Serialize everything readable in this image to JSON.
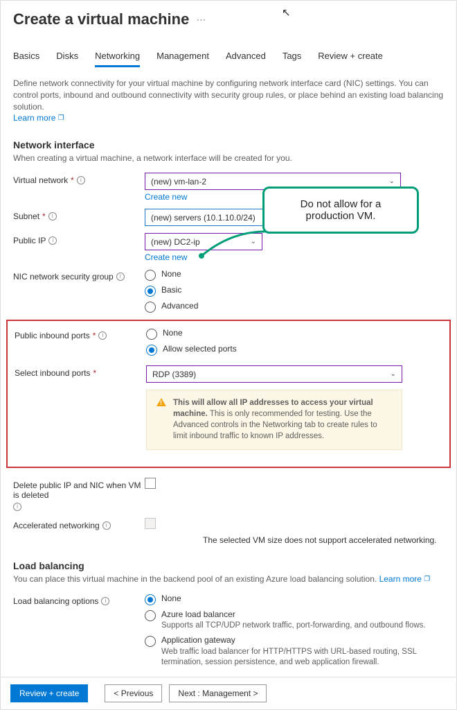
{
  "header": {
    "title": "Create a virtual machine"
  },
  "tabs": [
    "Basics",
    "Disks",
    "Networking",
    "Management",
    "Advanced",
    "Tags",
    "Review + create"
  ],
  "active_tab_index": 2,
  "intro": {
    "text": "Define network connectivity for your virtual machine by configuring network interface card (NIC) settings. You can control ports, inbound and outbound connectivity with security group rules, or place behind an existing load balancing solution.",
    "learn_more": "Learn more"
  },
  "network_interface": {
    "title": "Network interface",
    "subtitle": "When creating a virtual machine, a network interface will be created for you.",
    "virtual_network": {
      "label": "Virtual network",
      "value": "(new) vm-lan-2",
      "create_new": "Create new"
    },
    "subnet": {
      "label": "Subnet",
      "value": "(new) servers (10.1.10.0/24)"
    },
    "public_ip": {
      "label": "Public IP",
      "value": "(new) DC2-ip",
      "create_new": "Create new"
    },
    "nsg": {
      "label": "NIC network security group",
      "options": [
        "None",
        "Basic",
        "Advanced"
      ],
      "selected": 1
    },
    "public_ports": {
      "label": "Public inbound ports",
      "options": [
        "None",
        "Allow selected ports"
      ],
      "selected": 1
    },
    "inbound_ports": {
      "label": "Select inbound ports",
      "value": "RDP (3389)"
    },
    "warning": {
      "bold": "This will allow all IP addresses to access your virtual machine.",
      "rest": "This is only recommended for testing.  Use the Advanced controls in the Networking tab to create rules to limit inbound traffic to known IP addresses."
    },
    "delete_nic": {
      "label": "Delete public IP and NIC when VM is deleted"
    },
    "accel": {
      "label": "Accelerated networking",
      "note": "The selected VM size does not support accelerated networking."
    }
  },
  "load_balancing": {
    "title": "Load balancing",
    "subtitle": "You can place this virtual machine in the backend pool of an existing Azure load balancing solution.",
    "learn_more": "Learn more",
    "label": "Load balancing options",
    "options": [
      {
        "name": "None",
        "desc": ""
      },
      {
        "name": "Azure load balancer",
        "desc": "Supports all TCP/UDP network traffic, port-forwarding, and outbound flows."
      },
      {
        "name": "Application gateway",
        "desc": "Web traffic load balancer for HTTP/HTTPS with URL-based routing, SSL termination, session persistence, and web application firewall."
      }
    ],
    "selected": 0
  },
  "callout": {
    "line1": "Do not allow for a",
    "line2": "production VM."
  },
  "footer": {
    "review": "Review + create",
    "previous": "< Previous",
    "next": "Next : Management >"
  }
}
